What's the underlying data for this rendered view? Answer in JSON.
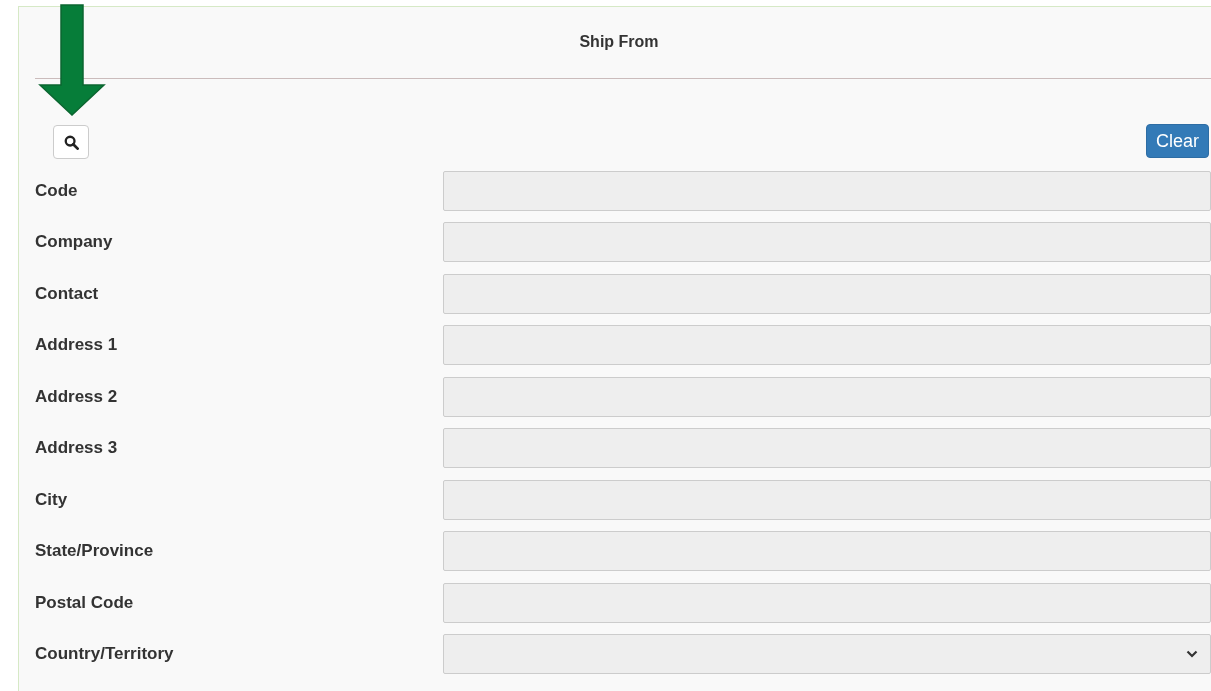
{
  "panel": {
    "title": "Ship From"
  },
  "toolbar": {
    "clear_button": "Clear"
  },
  "fields": [
    {
      "label": "Code",
      "kind": "text"
    },
    {
      "label": "Company",
      "kind": "text"
    },
    {
      "label": "Contact",
      "kind": "text"
    },
    {
      "label": "Address 1",
      "kind": "text"
    },
    {
      "label": "Address 2",
      "kind": "text"
    },
    {
      "label": "Address 3",
      "kind": "text"
    },
    {
      "label": "City",
      "kind": "text"
    },
    {
      "label": "State/Province",
      "kind": "text"
    },
    {
      "label": "Postal Code",
      "kind": "text"
    },
    {
      "label": "Country/Territory",
      "kind": "select"
    }
  ]
}
